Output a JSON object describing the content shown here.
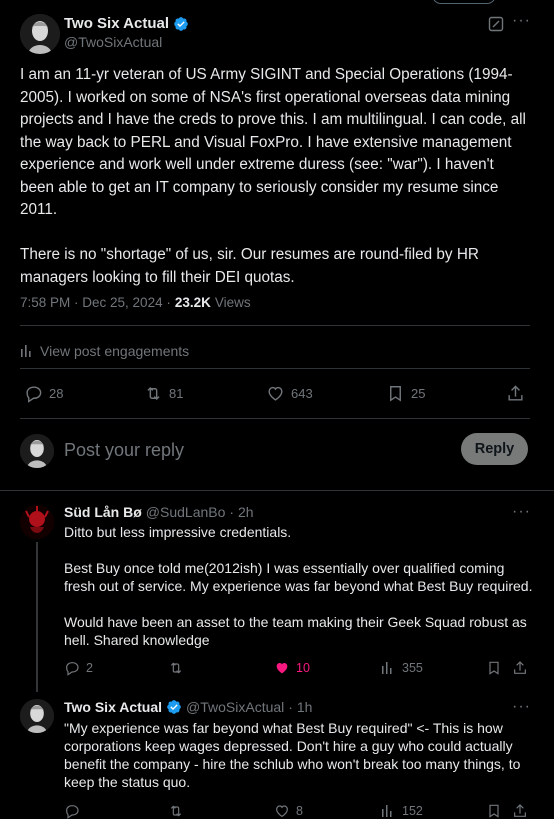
{
  "post": {
    "author_name": "Two Six Actual",
    "author_handle": "@TwoSixActual",
    "text": "I am an 11-yr veteran of US Army SIGINT and Special Operations (1994-2005). I worked on some of NSA's first operational overseas data mining projects and I have the creds to prove this. I am multilingual. I can code, all the way back to PERL and Visual FoxPro. I have extensive management experience and work well under extreme duress (see: \"war\"). I haven't been able to get an IT company to seriously consider my resume since 2011.\n\nThere is no \"shortage\" of us, sir. Our resumes are round-filed by HR managers looking to fill their DEI quotas.",
    "time": "7:58 PM · Dec 25, 2024 ·",
    "views_count": "23.2K",
    "views_label": "Views",
    "engagements_label": "View post engagements",
    "replies": "28",
    "reposts": "81",
    "likes": "643",
    "bookmarks": "25"
  },
  "reply_box": {
    "placeholder": "Post your reply",
    "button_label": "Reply"
  },
  "comments": [
    {
      "author_name": "Süd Lån Bø",
      "author_handle": "@SudLanBo",
      "time": "· 2h",
      "text": "Ditto but less impressive credentials.\n\nBest Buy once told me(2012ish) I was essentially over qualified coming fresh out of service. My experience was far beyond what Best Buy required.\n\nWould have been an asset to the team making their Geek Squad robust as hell. Shared knowledge",
      "replies": "2",
      "reposts": "",
      "likes": "10",
      "views": "355"
    },
    {
      "author_name": "Two Six Actual",
      "author_handle": "@TwoSixActual",
      "time": "· 1h",
      "text": "\"My experience was far beyond what Best Buy required\" <- This is how corporations keep wages depressed. Don't hire a guy who could actually benefit the company - hire the schlub who won't break too many things, to keep the status quo.",
      "replies": "",
      "reposts": "",
      "likes": "8",
      "views": "152"
    }
  ],
  "colors": {
    "background": "#000000",
    "text": "#e7e9ea",
    "muted": "#71767b",
    "divider": "#2f3336",
    "verified": "#1d9bf0",
    "like": "#f91880"
  }
}
